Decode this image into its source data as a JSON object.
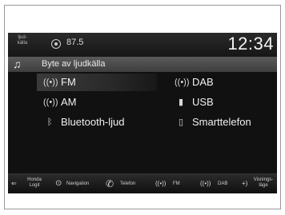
{
  "status": {
    "source_tag_line1": "ljud-",
    "source_tag_line2": "källa",
    "frequency": "87.5",
    "clock": "12:34"
  },
  "header": {
    "title": "Byte av ljudkälla"
  },
  "sources": [
    {
      "label": "FM",
      "icon": "radio-icon",
      "selected": true
    },
    {
      "label": "DAB",
      "icon": "radio-icon",
      "selected": false
    },
    {
      "label": "AM",
      "icon": "radio-icon",
      "selected": false
    },
    {
      "label": "USB",
      "icon": "usb-icon",
      "selected": false
    },
    {
      "label": "Bluetooth-ljud",
      "icon": "bluetooth-icon",
      "selected": false
    },
    {
      "label": "Smarttelefon",
      "icon": "phone-icon",
      "selected": false
    }
  ],
  "bottom_bar": {
    "home_line1": "Honda",
    "home_line2": "Logit",
    "navigation": "Navigation",
    "phone": "Telefon",
    "fm": "FM",
    "dab": "DAB",
    "view_line1": "Visnings-",
    "view_line2": "läge"
  }
}
